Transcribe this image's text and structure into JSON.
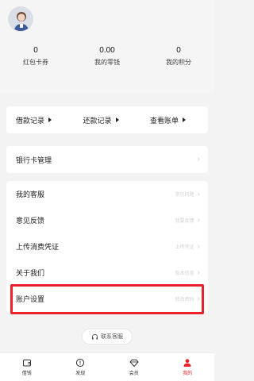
{
  "stats": [
    {
      "value": "0",
      "label": "红包卡券"
    },
    {
      "value": "0.00",
      "label": "我的零钱"
    },
    {
      "value": "0",
      "label": "我的积分"
    }
  ],
  "records": [
    {
      "label": "借款记录"
    },
    {
      "label": "还款记录"
    },
    {
      "label": "查看账单"
    }
  ],
  "bank": {
    "label": "银行卡管理"
  },
  "menu": [
    {
      "label": "我的客服",
      "hint": "常见问题"
    },
    {
      "label": "意见反馈",
      "hint": "我要反馈"
    },
    {
      "label": "上传消费凭证",
      "hint": "上传凭证"
    },
    {
      "label": "关于我们",
      "hint": "版本信息"
    },
    {
      "label": "账户设置",
      "hint": "修改密码"
    }
  ],
  "contact": {
    "label": "联系客服"
  },
  "tabs": [
    {
      "label": "借钱",
      "icon": "wallet-icon"
    },
    {
      "label": "发现",
      "icon": "compass-icon"
    },
    {
      "label": "会员",
      "icon": "diamond-icon"
    },
    {
      "label": "我的",
      "icon": "user-icon"
    }
  ],
  "colors": {
    "accent": "#e8212b",
    "background": "#f3f3f3"
  }
}
